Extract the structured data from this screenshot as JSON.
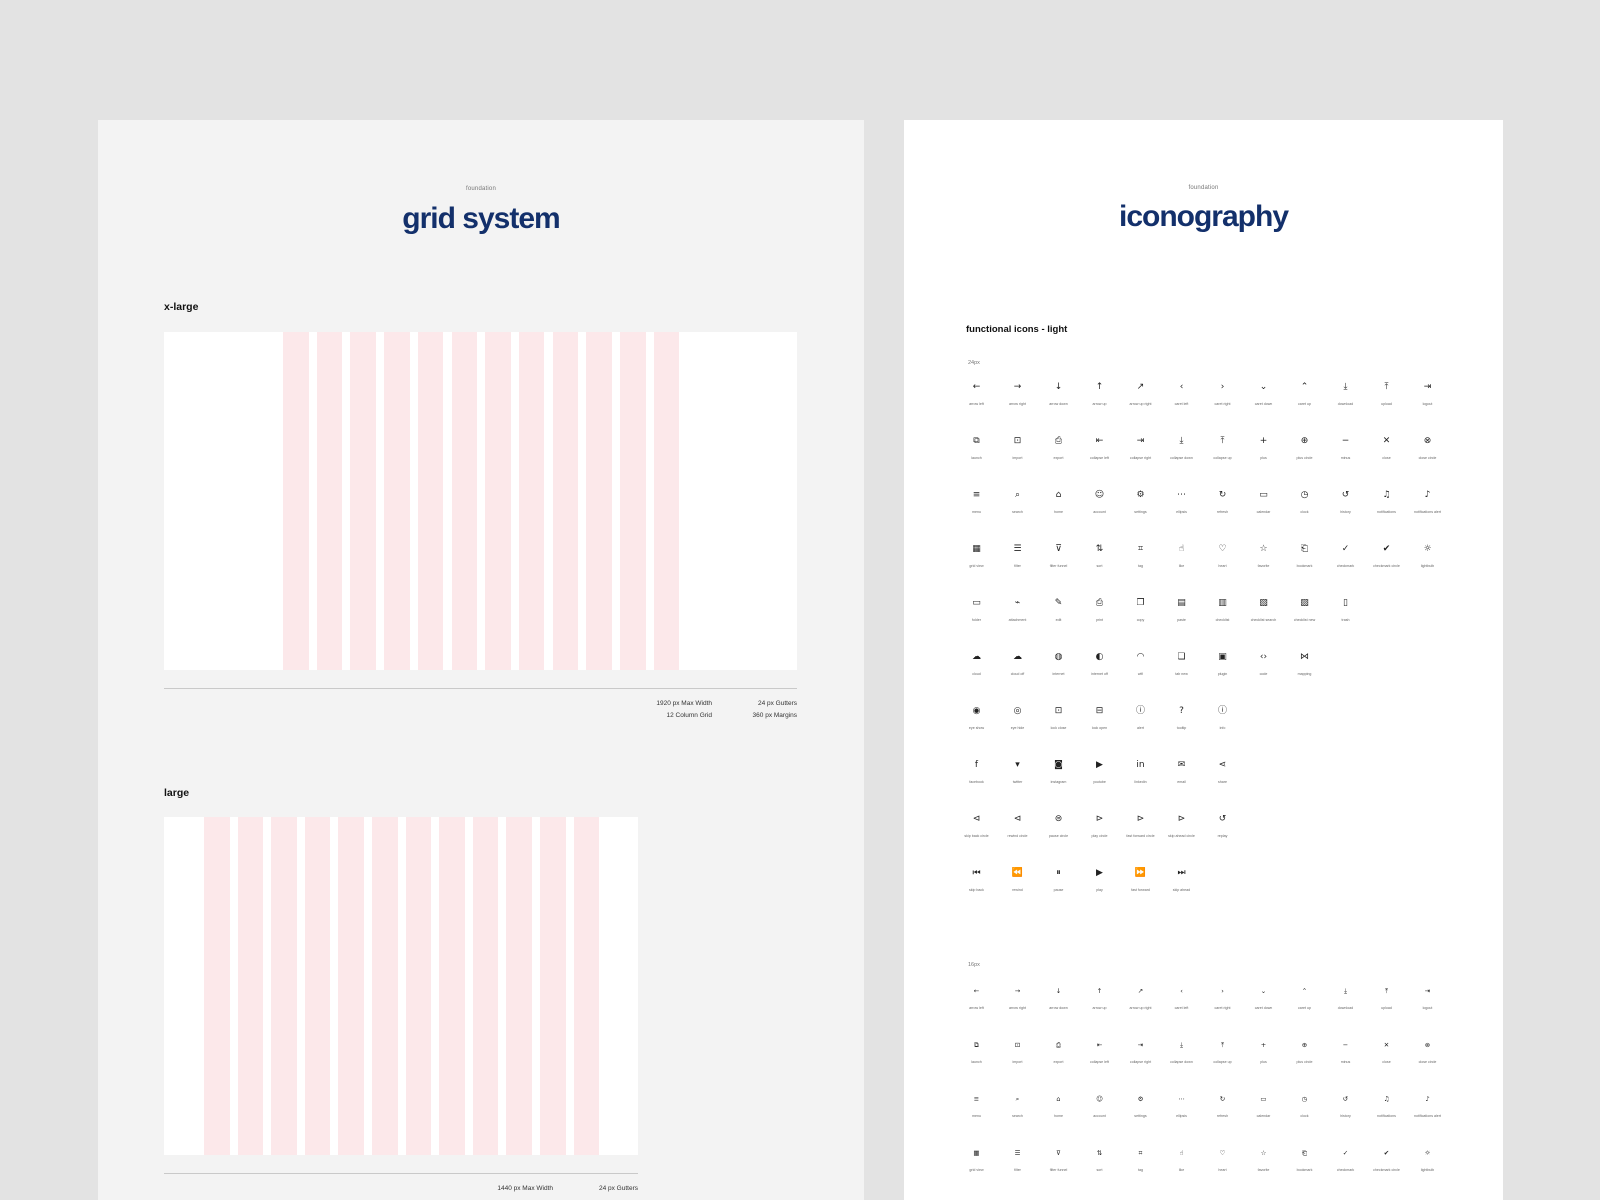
{
  "grid_panel": {
    "eyebrow": "foundation",
    "title": "grid system",
    "xlarge": {
      "label": "x-large",
      "columns": 12,
      "specs": [
        "1920 px Max Width",
        "24 px Gutters",
        "12 Column Grid",
        "360 px Margins"
      ]
    },
    "large": {
      "label": "large",
      "columns": 12,
      "specs": [
        "1440 px Max Width",
        "24 px Gutters"
      ]
    }
  },
  "icons_panel": {
    "eyebrow": "foundation",
    "title": "iconography",
    "section_title": "functional icons - light",
    "size_24": "24px",
    "size_16": "16px",
    "rows": [
      [
        [
          "←",
          "arrow left"
        ],
        [
          "→",
          "arrow right"
        ],
        [
          "↓",
          "arrow down"
        ],
        [
          "↑",
          "arrow up"
        ],
        [
          "↗",
          "arrow up right"
        ],
        [
          "‹",
          "caret left"
        ],
        [
          "›",
          "caret right"
        ],
        [
          "⌄",
          "caret down"
        ],
        [
          "⌃",
          "caret up"
        ],
        [
          "⤓",
          "download"
        ],
        [
          "⤒",
          "upload"
        ],
        [
          "⇥",
          "logout"
        ]
      ],
      [
        [
          "⧉",
          "launch"
        ],
        [
          "⊡",
          "import"
        ],
        [
          "⎙",
          "export"
        ],
        [
          "⇤",
          "collapse left"
        ],
        [
          "⇥",
          "collapse right"
        ],
        [
          "⤓",
          "collapse down"
        ],
        [
          "⤒",
          "collapse up"
        ],
        [
          "+",
          "plus"
        ],
        [
          "⊕",
          "plus circle"
        ],
        [
          "−",
          "minus"
        ],
        [
          "✕",
          "close"
        ],
        [
          "⊗",
          "close circle"
        ]
      ],
      [
        [
          "≡",
          "menu"
        ],
        [
          "⌕",
          "search"
        ],
        [
          "⌂",
          "home"
        ],
        [
          "☺",
          "account"
        ],
        [
          "⚙",
          "settings"
        ],
        [
          "⋯",
          "ellipsis"
        ],
        [
          "↻",
          "refresh"
        ],
        [
          "▭",
          "calendar"
        ],
        [
          "◷",
          "clock"
        ],
        [
          "↺",
          "history"
        ],
        [
          "♫",
          "notifications"
        ],
        [
          "♪",
          "notifications alert"
        ]
      ],
      [
        [
          "▦",
          "grid view"
        ],
        [
          "☰",
          "filter"
        ],
        [
          "⊽",
          "filter funnel"
        ],
        [
          "⇅",
          "sort"
        ],
        [
          "⌗",
          "tag"
        ],
        [
          "☝",
          "like"
        ],
        [
          "♡",
          "heart"
        ],
        [
          "☆",
          "favorite"
        ],
        [
          "⎗",
          "bookmark"
        ],
        [
          "✓",
          "checkmark"
        ],
        [
          "✔",
          "checkmark circle"
        ],
        [
          "☼",
          "lightbulb"
        ]
      ],
      [
        [
          "▭",
          "folder"
        ],
        [
          "⌁",
          "attachment"
        ],
        [
          "✎",
          "edit"
        ],
        [
          "⎙",
          "print"
        ],
        [
          "❐",
          "copy"
        ],
        [
          "▤",
          "paste"
        ],
        [
          "▥",
          "checklist"
        ],
        [
          "▧",
          "checklist search"
        ],
        [
          "▨",
          "checklist new"
        ],
        [
          "▯",
          "trash"
        ]
      ],
      [
        [
          "☁",
          "cloud"
        ],
        [
          "☁",
          "cloud off"
        ],
        [
          "◍",
          "internet"
        ],
        [
          "◐",
          "internet off"
        ],
        [
          "◠",
          "wifi"
        ],
        [
          "❏",
          "tab new"
        ],
        [
          "▣",
          "plugin"
        ],
        [
          "‹›",
          "code"
        ],
        [
          "⋈",
          "mapping"
        ]
      ],
      [
        [
          "◉",
          "eye show"
        ],
        [
          "◎",
          "eye hide"
        ],
        [
          "⊡",
          "lock close"
        ],
        [
          "⊟",
          "lock open"
        ],
        [
          "ⓘ",
          "alert"
        ],
        [
          "?",
          "tooltip"
        ],
        [
          "ⓘ",
          "info"
        ]
      ],
      [
        [
          "f",
          "facebook"
        ],
        [
          "▾",
          "twitter"
        ],
        [
          "◙",
          "instagram"
        ],
        [
          "▶",
          "youtube"
        ],
        [
          "in",
          "linkedin"
        ],
        [
          "✉",
          "email"
        ],
        [
          "⋖",
          "share"
        ]
      ],
      [
        [
          "⊲",
          "skip back circle"
        ],
        [
          "⊲",
          "rewind circle"
        ],
        [
          "⊜",
          "pause circle"
        ],
        [
          "⊳",
          "play circle"
        ],
        [
          "⊳",
          "fast forward circle"
        ],
        [
          "⊳",
          "skip ahead circle"
        ],
        [
          "↺",
          "replay"
        ]
      ],
      [
        [
          "⏮",
          "skip back"
        ],
        [
          "⏪",
          "rewind"
        ],
        [
          "⏸",
          "pause"
        ],
        [
          "▶",
          "play"
        ],
        [
          "⏩",
          "fast forward"
        ],
        [
          "⏭",
          "skip ahead"
        ]
      ]
    ],
    "rows_16": [
      [
        [
          "←",
          "arrow left"
        ],
        [
          "→",
          "arrow right"
        ],
        [
          "↓",
          "arrow down"
        ],
        [
          "↑",
          "arrow up"
        ],
        [
          "↗",
          "arrow up right"
        ],
        [
          "‹",
          "caret left"
        ],
        [
          "›",
          "caret right"
        ],
        [
          "⌄",
          "caret down"
        ],
        [
          "⌃",
          "caret up"
        ],
        [
          "⤓",
          "download"
        ],
        [
          "⤒",
          "upload"
        ],
        [
          "⇥",
          "logout"
        ]
      ],
      [
        [
          "⧉",
          "launch"
        ],
        [
          "⊡",
          "import"
        ],
        [
          "⎙",
          "export"
        ],
        [
          "⇤",
          "collapse left"
        ],
        [
          "⇥",
          "collapse right"
        ],
        [
          "⤓",
          "collapse down"
        ],
        [
          "⤒",
          "collapse up"
        ],
        [
          "+",
          "plus"
        ],
        [
          "⊕",
          "plus circle"
        ],
        [
          "−",
          "minus"
        ],
        [
          "✕",
          "close"
        ],
        [
          "⊗",
          "close circle"
        ]
      ],
      [
        [
          "≡",
          "menu"
        ],
        [
          "⌕",
          "search"
        ],
        [
          "⌂",
          "home"
        ],
        [
          "☺",
          "account"
        ],
        [
          "⚙",
          "settings"
        ],
        [
          "⋯",
          "ellipsis"
        ],
        [
          "↻",
          "refresh"
        ],
        [
          "▭",
          "calendar"
        ],
        [
          "◷",
          "clock"
        ],
        [
          "↺",
          "history"
        ],
        [
          "♫",
          "notifications"
        ],
        [
          "♪",
          "notifications alert"
        ]
      ],
      [
        [
          "▦",
          "grid view"
        ],
        [
          "☰",
          "filter"
        ],
        [
          "⊽",
          "filter funnel"
        ],
        [
          "⇅",
          "sort"
        ],
        [
          "⌗",
          "tag"
        ],
        [
          "☝",
          "like"
        ],
        [
          "♡",
          "heart"
        ],
        [
          "☆",
          "favorite"
        ],
        [
          "⎗",
          "bookmark"
        ],
        [
          "✓",
          "checkmark"
        ],
        [
          "✔",
          "checkmark circle"
        ],
        [
          "☼",
          "lightbulb"
        ]
      ]
    ]
  }
}
